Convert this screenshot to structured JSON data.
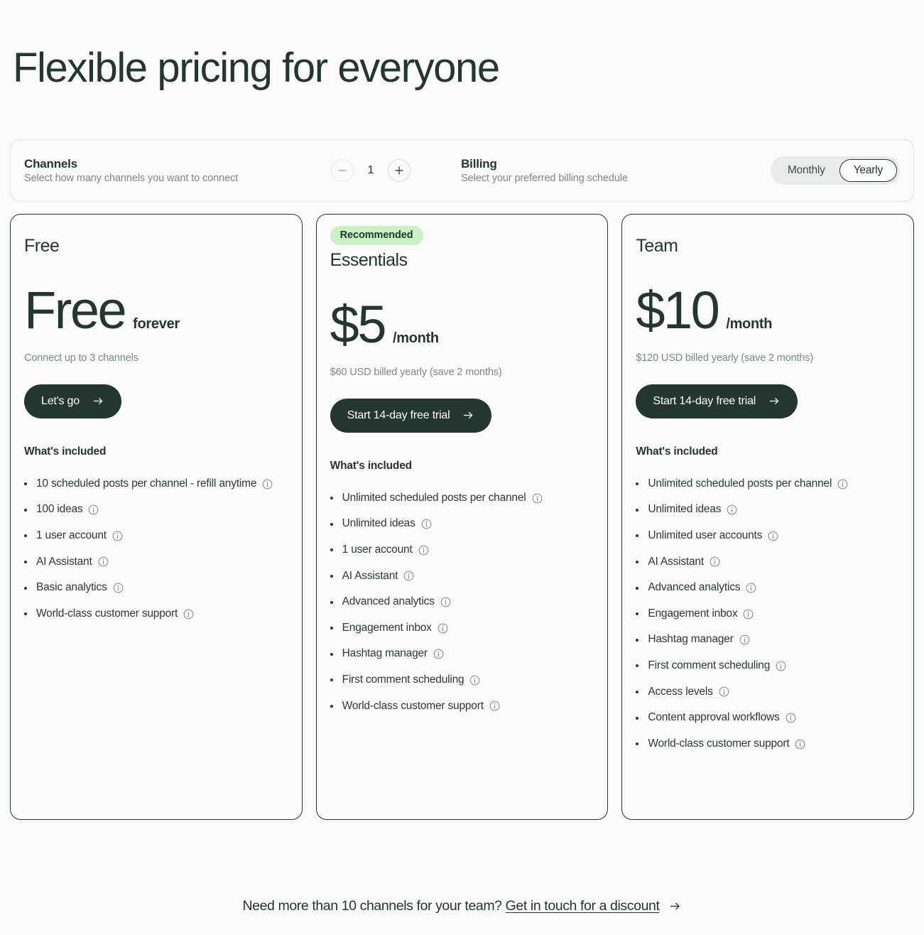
{
  "header": {
    "title": "Flexible pricing for everyone"
  },
  "options": {
    "channels": {
      "title": "Channels",
      "subtitle": "Select how many channels you want to connect",
      "value": "1",
      "decrement_label": "−",
      "increment_label": "+"
    },
    "billing": {
      "title": "Billing",
      "subtitle": "Select your preferred billing schedule",
      "options": [
        "Monthly",
        "Yearly"
      ],
      "selected": "Yearly"
    }
  },
  "plans": [
    {
      "name": "Free",
      "badge": null,
      "price": "Free",
      "price_suffix": "forever",
      "note": "Connect up to 3 channels",
      "cta": "Let's go",
      "included_title": "What's included",
      "features": [
        "10 scheduled posts per channel - refill anytime",
        "100 ideas",
        "1 user account",
        "AI Assistant",
        "Basic analytics",
        "World-class customer support"
      ]
    },
    {
      "name": "Essentials",
      "badge": "Recommended",
      "price": "$5",
      "price_suffix": "/month",
      "note": "$60 USD billed yearly (save 2 months)",
      "cta": "Start 14-day free trial",
      "included_title": "What's included",
      "features": [
        "Unlimited scheduled posts per channel",
        "Unlimited ideas",
        "1 user account",
        "AI Assistant",
        "Advanced analytics",
        "Engagement inbox",
        "Hashtag manager",
        "First comment scheduling",
        "World-class customer support"
      ]
    },
    {
      "name": "Team",
      "badge": null,
      "price": "$10",
      "price_suffix": "/month",
      "note": "$120 USD billed yearly (save 2 months)",
      "cta": "Start 14-day free trial",
      "included_title": "What's included",
      "features": [
        "Unlimited scheduled posts per channel",
        "Unlimited ideas",
        "Unlimited user accounts",
        "AI Assistant",
        "Advanced analytics",
        "Engagement inbox",
        "Hashtag manager",
        "First comment scheduling",
        "Access levels",
        "Content approval workflows",
        "World-class customer support"
      ]
    }
  ],
  "footer": {
    "text": "Need more than 10 channels for your team?",
    "link": "Get in touch for a discount"
  },
  "colors": {
    "page_background": "#fafafa",
    "ink": "#23362f",
    "muted": "#7c8a86",
    "badge_green": "#c9f1c4",
    "toggle_track": "#e9ebeb",
    "card_border": "#23362f",
    "bar_border": "#e3e5e5"
  }
}
